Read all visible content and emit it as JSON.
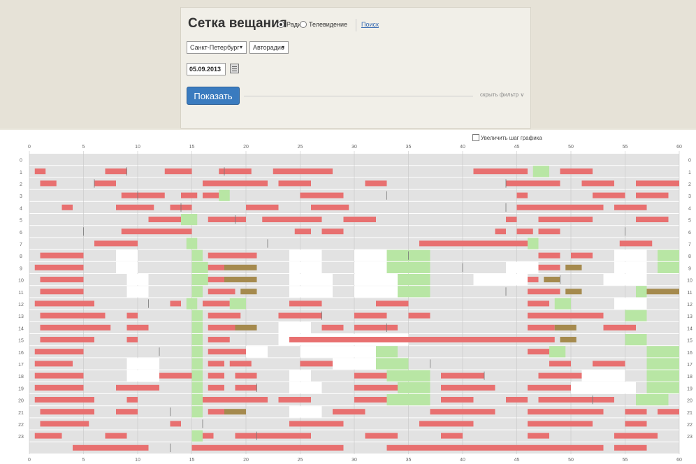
{
  "header": {
    "title": "Сетка вещания",
    "radio_label": "Радио",
    "tv_label": "Телевидение",
    "search_link": "Поиск"
  },
  "filters": {
    "city": "Санкт-Петербург",
    "station": "Авторадио",
    "date": "05.09.2013",
    "show_button": "Показать",
    "hide_filter": "скрыть фильтр"
  },
  "chart_controls": {
    "enlarge_label": "Увеличить шаг графика"
  },
  "colors": {
    "track": "#e2e2e2",
    "ad": "#e87070",
    "ad_dark": "#c8584e",
    "overlap": "#a58a4e",
    "green": "#b8e6a4",
    "white": "#ffffff",
    "grid": "#c8c8c8",
    "marker": "#777777"
  },
  "chart_data": {
    "type": "timeline",
    "x_ticks": [
      0,
      5,
      10,
      15,
      20,
      25,
      30,
      35,
      40,
      45,
      50,
      55,
      60
    ],
    "rows": [
      "0",
      "1",
      "2",
      "3",
      "4",
      "5",
      "6",
      "7",
      "8",
      "9",
      "10",
      "11",
      "12",
      "13",
      "14",
      "15",
      "16",
      "17",
      "18",
      "19",
      "20",
      "21",
      "22",
      "23"
    ],
    "xlim": [
      0,
      60
    ],
    "blocks": [
      {
        "r": 0,
        "s": []
      },
      {
        "r": 1,
        "s": [
          [
            0.5,
            1.5,
            "r"
          ],
          [
            7,
            9,
            "r"
          ],
          [
            12.5,
            15,
            "r"
          ],
          [
            17.5,
            20.5,
            "r"
          ],
          [
            22.5,
            28,
            "r"
          ],
          [
            41,
            46,
            "r"
          ],
          [
            46.5,
            48,
            "g"
          ],
          [
            49,
            52,
            "r"
          ]
        ]
      },
      {
        "r": 2,
        "s": [
          [
            1,
            2.5,
            "r"
          ],
          [
            6,
            8,
            "r"
          ],
          [
            16,
            22,
            "r"
          ],
          [
            23,
            26,
            "r"
          ],
          [
            31,
            33,
            "r"
          ],
          [
            44,
            49,
            "r"
          ],
          [
            51,
            54,
            "r"
          ],
          [
            56,
            60,
            "r"
          ]
        ]
      },
      {
        "r": 3,
        "s": [
          [
            8.5,
            12.5,
            "r"
          ],
          [
            14,
            15.5,
            "r"
          ],
          [
            16,
            17.5,
            "r"
          ],
          [
            17.5,
            18.5,
            "g"
          ],
          [
            25,
            29,
            "r"
          ],
          [
            45,
            46,
            "r"
          ],
          [
            52,
            55,
            "r"
          ],
          [
            56,
            59,
            "r"
          ]
        ]
      },
      {
        "r": 4,
        "s": [
          [
            3,
            4,
            "r"
          ],
          [
            8,
            11.5,
            "r"
          ],
          [
            13,
            15,
            "r"
          ],
          [
            20,
            23,
            "r"
          ],
          [
            26,
            29.5,
            "r"
          ],
          [
            45,
            47,
            "r"
          ],
          [
            47,
            53,
            "r"
          ],
          [
            54,
            57,
            "r"
          ]
        ]
      },
      {
        "r": 5,
        "s": [
          [
            11,
            14,
            "r"
          ],
          [
            14,
            15.5,
            "g"
          ],
          [
            16.5,
            20,
            "r"
          ],
          [
            21.5,
            27,
            "r"
          ],
          [
            29,
            32,
            "r"
          ],
          [
            44,
            45,
            "r"
          ],
          [
            47,
            52,
            "r"
          ],
          [
            56,
            59,
            "r"
          ]
        ]
      },
      {
        "r": 6,
        "s": [
          [
            8.5,
            15,
            "r"
          ],
          [
            24.5,
            26,
            "r"
          ],
          [
            27,
            29,
            "r"
          ],
          [
            43,
            44,
            "r"
          ],
          [
            45,
            46.5,
            "r"
          ],
          [
            47,
            49,
            "r"
          ]
        ]
      },
      {
        "r": 7,
        "s": [
          [
            6,
            10,
            "r"
          ],
          [
            14.5,
            15.5,
            "g"
          ],
          [
            36,
            46,
            "r"
          ],
          [
            46,
            47,
            "g"
          ],
          [
            54.5,
            57.5,
            "r"
          ]
        ]
      },
      {
        "r": 8,
        "s": [
          [
            1,
            5,
            "r"
          ],
          [
            8,
            10,
            "w"
          ],
          [
            15,
            16,
            "g"
          ],
          [
            16.5,
            21,
            "r"
          ],
          [
            24,
            27,
            "w"
          ],
          [
            30,
            33,
            "w"
          ],
          [
            33,
            37,
            "g"
          ],
          [
            47,
            49,
            "r"
          ],
          [
            50,
            52,
            "r"
          ],
          [
            54,
            57,
            "w"
          ],
          [
            58,
            60,
            "g"
          ]
        ]
      },
      {
        "r": 9,
        "s": [
          [
            0.5,
            5,
            "r"
          ],
          [
            8,
            10,
            "w"
          ],
          [
            15,
            16.5,
            "g"
          ],
          [
            16.5,
            18,
            "r"
          ],
          [
            18,
            21,
            "o"
          ],
          [
            24,
            27,
            "w"
          ],
          [
            30,
            33,
            "w"
          ],
          [
            33,
            37,
            "g"
          ],
          [
            44,
            47,
            "w"
          ],
          [
            47,
            49,
            "r"
          ],
          [
            49.5,
            51,
            "o"
          ],
          [
            54,
            57,
            "w"
          ],
          [
            58,
            60,
            "g"
          ]
        ]
      },
      {
        "r": 10,
        "s": [
          [
            1,
            5,
            "r"
          ],
          [
            9,
            11,
            "w"
          ],
          [
            15,
            16.5,
            "g"
          ],
          [
            16.5,
            18,
            "r"
          ],
          [
            18,
            21,
            "o"
          ],
          [
            24,
            28,
            "w"
          ],
          [
            30,
            34,
            "w"
          ],
          [
            34,
            37,
            "g"
          ],
          [
            41,
            46,
            "w"
          ],
          [
            46,
            47,
            "r"
          ],
          [
            47.5,
            49,
            "o"
          ],
          [
            53,
            57,
            "w"
          ]
        ]
      },
      {
        "r": 11,
        "s": [
          [
            1,
            5,
            "r"
          ],
          [
            9,
            11,
            "w"
          ],
          [
            15,
            16,
            "g"
          ],
          [
            16.5,
            19,
            "r"
          ],
          [
            19.5,
            21,
            "o"
          ],
          [
            24,
            28,
            "w"
          ],
          [
            30,
            34,
            "w"
          ],
          [
            34,
            37,
            "g"
          ],
          [
            46,
            49,
            "r"
          ],
          [
            49.5,
            51,
            "o"
          ],
          [
            56,
            57,
            "g"
          ],
          [
            57,
            60,
            "o"
          ]
        ]
      },
      {
        "r": 12,
        "s": [
          [
            0.5,
            6,
            "r"
          ],
          [
            13,
            14,
            "r"
          ],
          [
            14.5,
            15.5,
            "g"
          ],
          [
            16,
            18.5,
            "r"
          ],
          [
            18.5,
            20,
            "g"
          ],
          [
            24,
            27,
            "r"
          ],
          [
            32,
            35,
            "r"
          ],
          [
            46,
            48,
            "r"
          ],
          [
            48.5,
            50,
            "g"
          ],
          [
            54,
            57,
            "w"
          ]
        ]
      },
      {
        "r": 13,
        "s": [
          [
            1,
            7,
            "r"
          ],
          [
            9,
            10,
            "r"
          ],
          [
            15,
            16,
            "g"
          ],
          [
            16.5,
            19.5,
            "r"
          ],
          [
            23,
            27,
            "r"
          ],
          [
            30,
            33,
            "r"
          ],
          [
            35,
            37,
            "r"
          ],
          [
            46,
            49,
            "r"
          ],
          [
            49,
            53,
            "r"
          ],
          [
            55,
            57,
            "g"
          ]
        ]
      },
      {
        "r": 14,
        "s": [
          [
            1,
            7.5,
            "r"
          ],
          [
            9,
            11,
            "r"
          ],
          [
            15,
            16,
            "g"
          ],
          [
            16.5,
            19,
            "r"
          ],
          [
            19,
            21,
            "o"
          ],
          [
            23,
            26,
            "w"
          ],
          [
            27,
            29,
            "r"
          ],
          [
            30,
            34,
            "r"
          ],
          [
            46,
            48.5,
            "r"
          ],
          [
            48.5,
            50.5,
            "o"
          ],
          [
            53,
            56,
            "r"
          ]
        ]
      },
      {
        "r": 15,
        "s": [
          [
            1,
            6,
            "r"
          ],
          [
            9,
            10,
            "r"
          ],
          [
            15,
            16,
            "g"
          ],
          [
            16.5,
            18.5,
            "r"
          ],
          [
            23,
            35,
            "w"
          ],
          [
            24,
            46,
            "r"
          ],
          [
            46,
            48.5,
            "r"
          ],
          [
            49,
            50.5,
            "o"
          ],
          [
            55,
            57,
            "g"
          ]
        ]
      },
      {
        "r": 16,
        "s": [
          [
            0.5,
            5,
            "r"
          ],
          [
            15,
            16,
            "g"
          ],
          [
            16.5,
            18,
            "r"
          ],
          [
            18,
            20,
            "r"
          ],
          [
            20,
            22,
            "w"
          ],
          [
            25,
            32,
            "w"
          ],
          [
            32,
            34,
            "g"
          ],
          [
            46,
            48,
            "r"
          ],
          [
            48,
            49.5,
            "g"
          ],
          [
            57,
            60,
            "g"
          ]
        ]
      },
      {
        "r": 17,
        "s": [
          [
            0.5,
            4,
            "r"
          ],
          [
            9,
            12,
            "w"
          ],
          [
            15,
            16,
            "g"
          ],
          [
            16.5,
            18,
            "r"
          ],
          [
            18.5,
            20.5,
            "r"
          ],
          [
            25,
            28,
            "r"
          ],
          [
            28,
            32,
            "w"
          ],
          [
            32,
            35,
            "g"
          ],
          [
            48,
            50,
            "r"
          ],
          [
            52,
            55,
            "r"
          ],
          [
            57,
            60,
            "g"
          ]
        ]
      },
      {
        "r": 18,
        "s": [
          [
            0.5,
            5,
            "r"
          ],
          [
            9,
            12,
            "w"
          ],
          [
            12,
            15,
            "r"
          ],
          [
            15,
            16,
            "g"
          ],
          [
            16.5,
            18,
            "r"
          ],
          [
            19,
            21,
            "r"
          ],
          [
            24,
            26,
            "w"
          ],
          [
            30,
            33,
            "r"
          ],
          [
            33,
            37,
            "g"
          ],
          [
            38,
            42,
            "r"
          ],
          [
            47,
            51,
            "r"
          ],
          [
            51,
            55,
            "w"
          ],
          [
            57,
            60,
            "g"
          ]
        ]
      },
      {
        "r": 19,
        "s": [
          [
            0.5,
            5,
            "r"
          ],
          [
            8,
            12,
            "r"
          ],
          [
            15,
            16,
            "g"
          ],
          [
            16.5,
            18,
            "r"
          ],
          [
            19,
            21,
            "r"
          ],
          [
            24,
            27,
            "w"
          ],
          [
            30,
            34,
            "r"
          ],
          [
            34,
            37,
            "g"
          ],
          [
            38,
            43,
            "r"
          ],
          [
            46,
            50,
            "r"
          ],
          [
            50,
            56,
            "w"
          ],
          [
            57,
            60,
            "g"
          ]
        ]
      },
      {
        "r": 20,
        "s": [
          [
            0.5,
            6,
            "r"
          ],
          [
            9,
            10,
            "r"
          ],
          [
            15,
            16,
            "g"
          ],
          [
            16,
            19,
            "r"
          ],
          [
            19,
            22,
            "r"
          ],
          [
            23,
            26,
            "r"
          ],
          [
            30,
            33,
            "r"
          ],
          [
            33,
            37,
            "g"
          ],
          [
            38,
            41,
            "r"
          ],
          [
            44,
            46,
            "r"
          ],
          [
            47,
            54,
            "r"
          ],
          [
            56,
            59,
            "g"
          ]
        ]
      },
      {
        "r": 21,
        "s": [
          [
            1,
            6,
            "r"
          ],
          [
            8,
            10,
            "r"
          ],
          [
            15,
            16,
            "g"
          ],
          [
            16.5,
            18,
            "r"
          ],
          [
            18,
            20,
            "o"
          ],
          [
            24,
            27,
            "w"
          ],
          [
            28,
            31,
            "r"
          ],
          [
            37,
            43,
            "r"
          ],
          [
            46,
            53,
            "r"
          ],
          [
            55,
            57,
            "r"
          ],
          [
            58,
            60,
            "r"
          ]
        ]
      },
      {
        "r": 22,
        "s": [
          [
            1,
            5.5,
            "r"
          ],
          [
            13,
            14,
            "r"
          ],
          [
            24,
            29,
            "r"
          ],
          [
            36,
            41,
            "r"
          ],
          [
            46,
            52,
            "r"
          ],
          [
            55,
            57,
            "r"
          ]
        ]
      },
      {
        "r": 23,
        "s": [
          [
            0.5,
            3,
            "r"
          ],
          [
            7,
            9,
            "r"
          ],
          [
            15,
            16,
            "g"
          ],
          [
            16,
            17,
            "r"
          ],
          [
            19,
            22,
            "r"
          ],
          [
            22,
            26,
            "r"
          ],
          [
            31,
            34,
            "r"
          ],
          [
            38,
            40,
            "r"
          ],
          [
            46,
            48,
            "r"
          ],
          [
            54,
            58,
            "r"
          ]
        ]
      },
      {
        "r": 24,
        "s": [
          [
            4,
            11,
            "r"
          ],
          [
            15,
            29,
            "r"
          ],
          [
            33,
            40,
            "r"
          ],
          [
            40,
            46,
            "r"
          ],
          [
            46,
            53,
            "r"
          ],
          [
            54,
            57,
            "r"
          ]
        ]
      }
    ]
  }
}
